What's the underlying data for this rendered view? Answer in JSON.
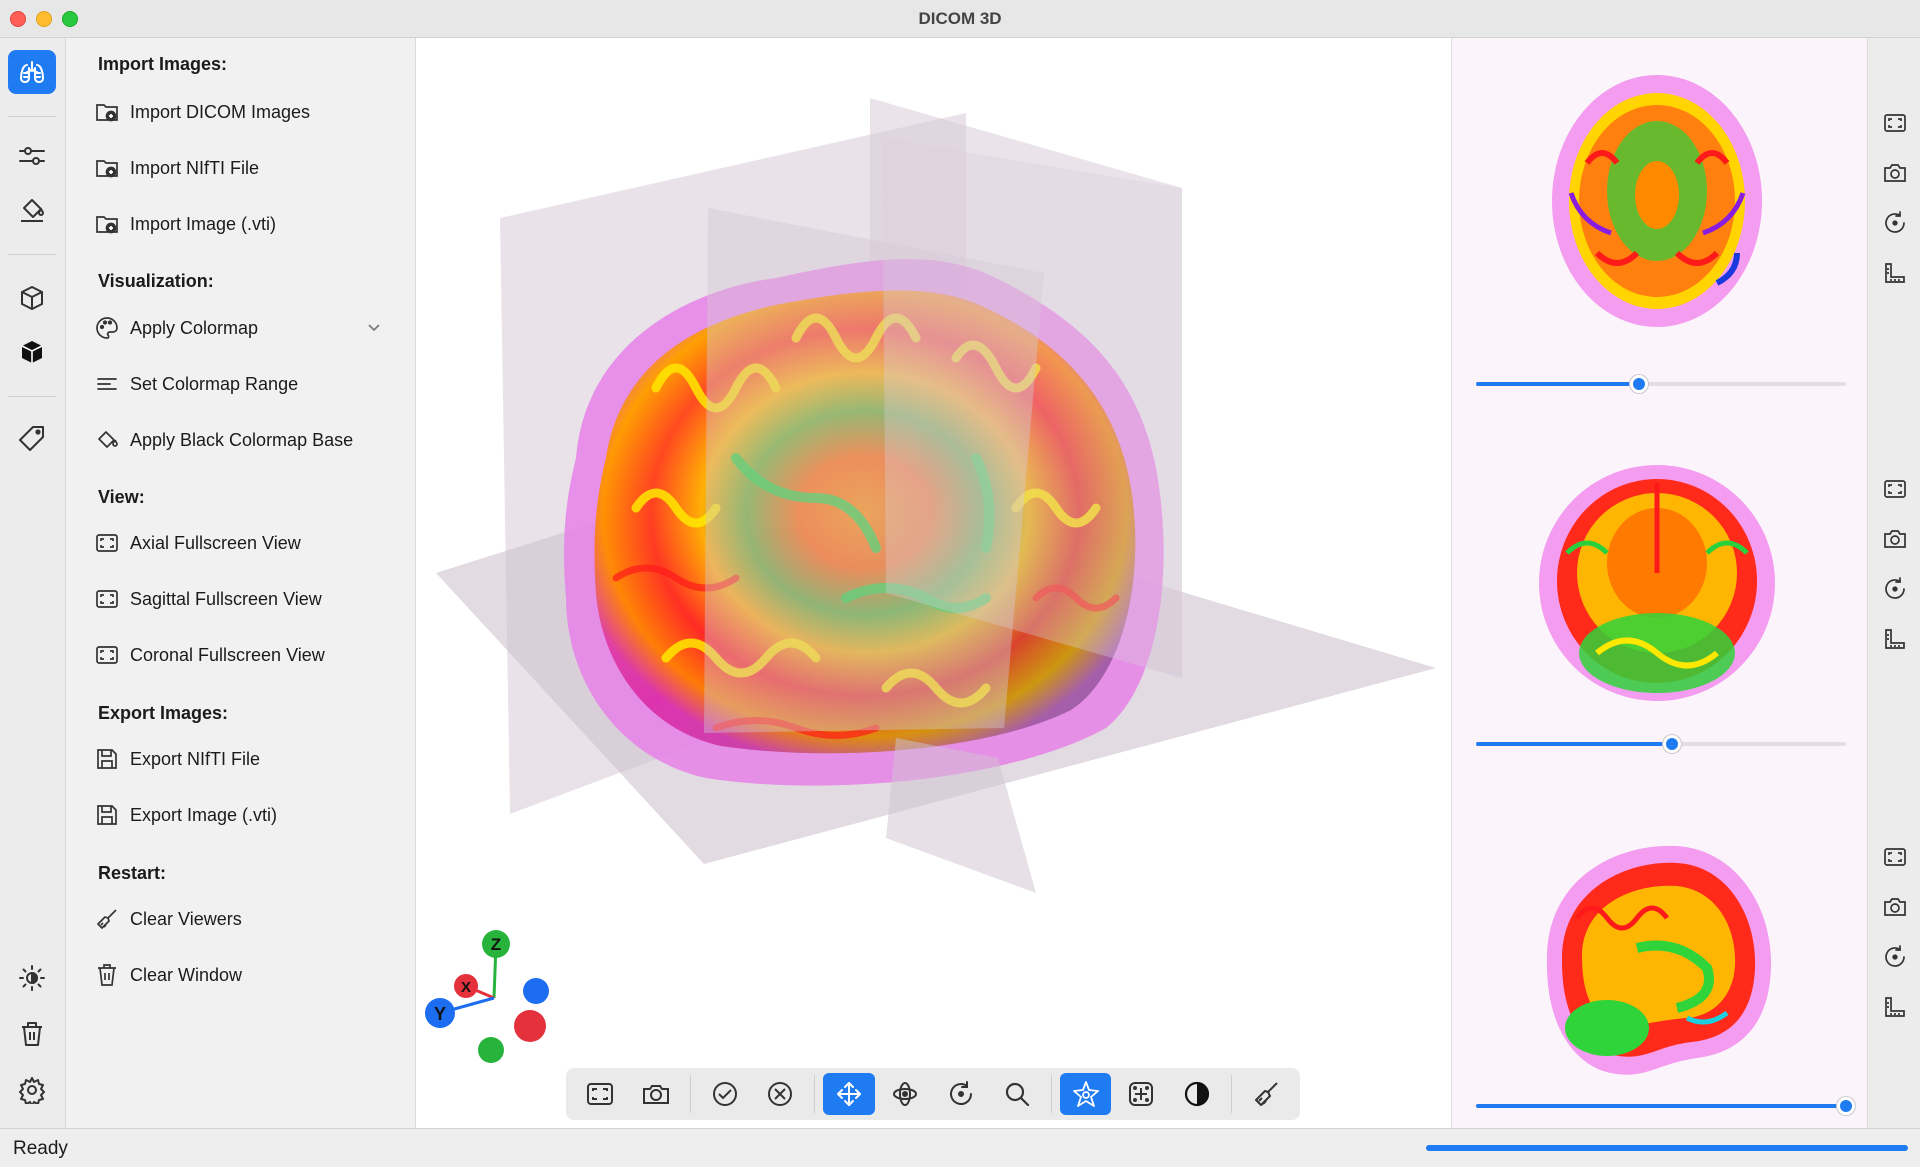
{
  "window": {
    "title": "DICOM 3D"
  },
  "rail": {
    "items": [
      {
        "icon": "lungs-icon",
        "active": true
      },
      {
        "icon": "sliders-icon"
      },
      {
        "icon": "paint-bucket-icon"
      },
      {
        "icon": "cube-outline-icon"
      },
      {
        "icon": "cube-solid-icon"
      },
      {
        "icon": "tag-icon"
      },
      {
        "icon": "brightness-icon"
      },
      {
        "icon": "trash-icon"
      },
      {
        "icon": "gear-icon"
      }
    ]
  },
  "menu": {
    "import": {
      "heading": "Import Images:",
      "dicom": "Import DICOM Images",
      "nifti": "Import NIfTI File",
      "vti": "Import Image (.vti)"
    },
    "visualization": {
      "heading": "Visualization:",
      "colormap": "Apply Colormap",
      "range": "Set Colormap Range",
      "black_base": "Apply Black Colormap Base"
    },
    "view": {
      "heading": "View:",
      "axial": "Axial Fullscreen View",
      "sagittal": "Sagittal Fullscreen View",
      "coronal": "Coronal Fullscreen View"
    },
    "export": {
      "heading": "Export Images:",
      "nifti": "Export NIfTI File",
      "vti": "Export Image (.vti)"
    },
    "restart": {
      "heading": "Restart:",
      "viewers": "Clear Viewers",
      "window": "Clear Window"
    }
  },
  "orientation": {
    "z": "Z",
    "x": "X",
    "y": "Y"
  },
  "toolbar": {
    "items": [
      {
        "icon": "fullscreen-icon"
      },
      {
        "icon": "camera-icon"
      },
      {
        "icon": "check-circle-icon"
      },
      {
        "icon": "x-circle-icon"
      },
      {
        "icon": "move-arrows-icon",
        "active": true
      },
      {
        "icon": "rotate-3d-icon"
      },
      {
        "icon": "rotate-icon"
      },
      {
        "icon": "zoom-icon"
      },
      {
        "icon": "crosshair-star-icon",
        "active": true
      },
      {
        "icon": "plus-grid-icon"
      },
      {
        "icon": "contrast-icon"
      },
      {
        "icon": "brush-icon"
      }
    ]
  },
  "previews": {
    "axial": {
      "slider": 0.44
    },
    "coronal": {
      "slider": 0.53
    },
    "sagittal": {
      "slider": 1.0
    }
  },
  "colors": {
    "accent": "#1f7bf2",
    "axis_x": "#e5313b",
    "axis_y": "#1d6df0",
    "axis_z": "#27b33c"
  },
  "status": {
    "text": "Ready",
    "progress": 1.0
  }
}
